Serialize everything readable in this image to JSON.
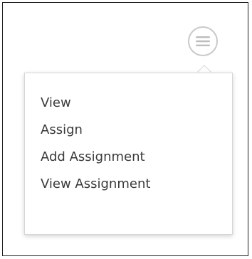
{
  "menu_button": {
    "icon": "hamburger-icon",
    "border_color": "#c9c9c9"
  },
  "dropdown": {
    "items": [
      {
        "label": "View"
      },
      {
        "label": "Assign"
      },
      {
        "label": "Add Assignment"
      },
      {
        "label": "View Assignment"
      }
    ],
    "text_color": "#3a3a3a"
  }
}
